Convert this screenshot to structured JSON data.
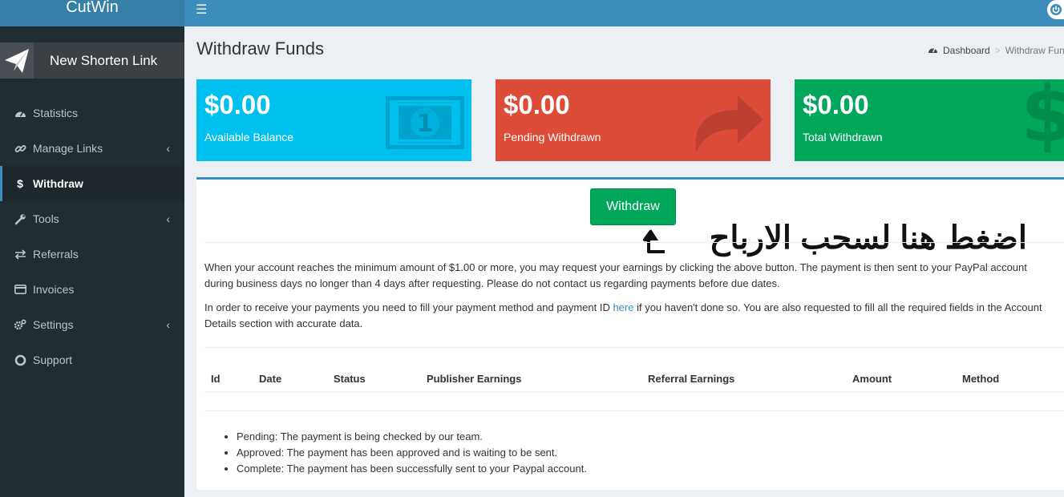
{
  "app": {
    "title": "CutWin"
  },
  "sidebar": {
    "new_link_label": "New Shorten Link",
    "items": [
      {
        "label": "Statistics",
        "icon": "dashboard-icon",
        "has_children": false
      },
      {
        "label": "Manage Links",
        "icon": "link-icon",
        "has_children": true
      },
      {
        "label": "Withdraw",
        "icon": "dollar-icon",
        "has_children": false,
        "active": true
      },
      {
        "label": "Tools",
        "icon": "wrench-icon",
        "has_children": true
      },
      {
        "label": "Referrals",
        "icon": "exchange-icon",
        "has_children": false
      },
      {
        "label": "Invoices",
        "icon": "credit-card-icon",
        "has_children": false
      },
      {
        "label": "Settings",
        "icon": "gears-icon",
        "has_children": true
      },
      {
        "label": "Support",
        "icon": "life-ring-icon",
        "has_children": false
      }
    ]
  },
  "header": {
    "page_title": "Withdraw Funds"
  },
  "breadcrumb": {
    "home": "Dashboard",
    "current": "Withdraw Fund"
  },
  "stats": [
    {
      "value": "$0.00",
      "label": "Available Balance",
      "color": "#00c0ef",
      "icon": "money-icon"
    },
    {
      "value": "$0.00",
      "label": "Pending Withdrawn",
      "color": "#dd4b39",
      "icon": "share-arrow-icon"
    },
    {
      "value": "$0.00",
      "label": "Total Withdrawn",
      "color": "#00a65a",
      "icon": "dollar-icon"
    }
  ],
  "main": {
    "withdraw_button": "Withdraw",
    "annotation": "اضغط هنا لسحب الارباح",
    "para1": "When your account reaches the minimum amount of $1.00 or more, you may request your earnings by clicking the above button. The payment is then sent to your PayPal account during business days no longer than 4 days after requesting. Please do not contact us regarding payments before due dates.",
    "para2_before": "In order to receive your payments you need to fill your payment method and payment ID ",
    "para2_link": "here",
    "para2_after": " if you haven't done so. You are also requested to fill all the required fields in the Account Details section with accurate data.",
    "table_headers": [
      "Id",
      "Date",
      "Status",
      "Publisher Earnings",
      "Referral Earnings",
      "Amount",
      "Method"
    ],
    "notes": [
      "Pending: The payment is being checked by our team.",
      "Approved: The payment has been approved and is waiting to be sent.",
      "Complete: The payment has been successfully sent to your Paypal account."
    ]
  }
}
